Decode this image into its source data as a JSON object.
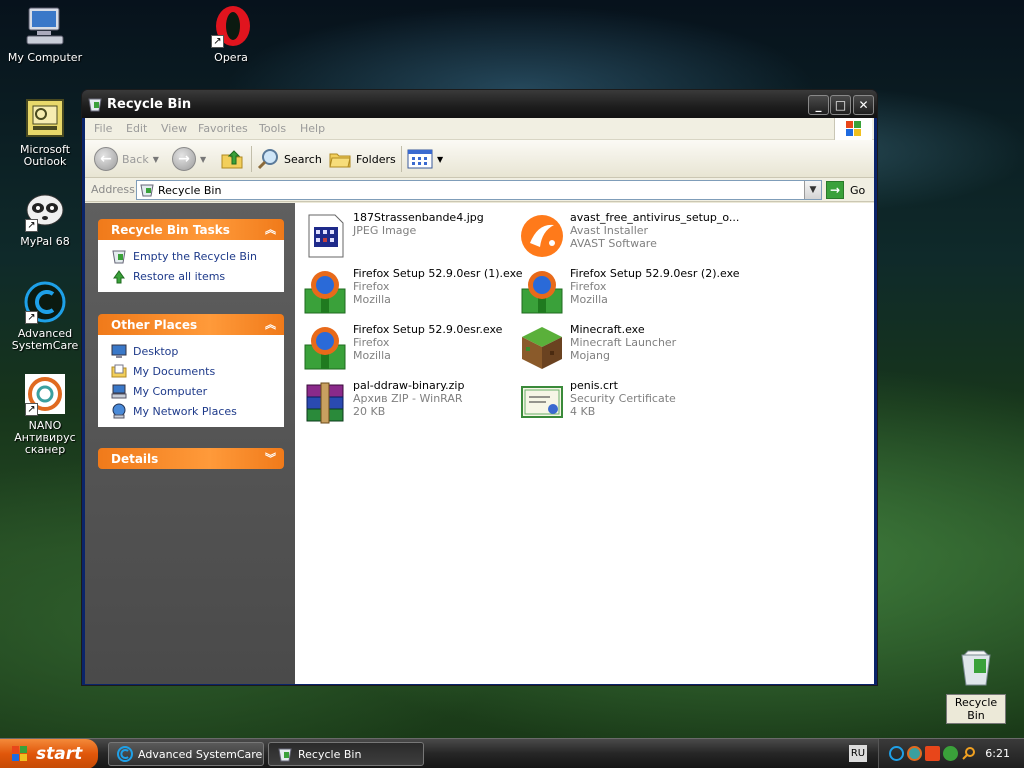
{
  "desktop": {
    "icons": [
      {
        "label": "My Computer"
      },
      {
        "label": "Opera"
      },
      {
        "label": "Microsoft Outlook"
      },
      {
        "label": "MyPal 68"
      },
      {
        "label": "Advanced SystemCare"
      },
      {
        "label": "NANO Антивирус сканер"
      }
    ],
    "recycle_bin_label": "Recycle Bin"
  },
  "window": {
    "title": "Recycle Bin",
    "menu": [
      "File",
      "Edit",
      "View",
      "Favorites",
      "Tools",
      "Help"
    ],
    "toolbar": {
      "back": "Back",
      "search": "Search",
      "folders": "Folders"
    },
    "address": {
      "label": "Address",
      "value": "Recycle Bin",
      "go": "Go"
    },
    "tasks_panel": {
      "title": "Recycle Bin Tasks",
      "items": [
        "Empty the Recycle Bin",
        "Restore all items"
      ]
    },
    "places_panel": {
      "title": "Other Places",
      "items": [
        "Desktop",
        "My Documents",
        "My Computer",
        "My Network Places"
      ]
    },
    "details_panel": {
      "title": "Details"
    },
    "files": [
      {
        "name": "187Strassenbande4.jpg",
        "type": "JPEG Image",
        "company": ""
      },
      {
        "name": "avast_free_antivirus_setup_o...",
        "type": "Avast Installer",
        "company": "AVAST Software"
      },
      {
        "name": "Firefox Setup 52.9.0esr (1).exe",
        "type": "Firefox",
        "company": "Mozilla"
      },
      {
        "name": "Firefox Setup 52.9.0esr (2).exe",
        "type": "Firefox",
        "company": "Mozilla"
      },
      {
        "name": "Firefox Setup 52.9.0esr.exe",
        "type": "Firefox",
        "company": "Mozilla"
      },
      {
        "name": "Minecraft.exe",
        "type": "Minecraft Launcher",
        "company": "Mojang"
      },
      {
        "name": "pal-ddraw-binary.zip",
        "type": "Архив ZIP - WinRAR",
        "company": "20 KB"
      },
      {
        "name": "penis.crt",
        "type": "Security Certificate",
        "company": "4 KB"
      }
    ]
  },
  "taskbar": {
    "start": "start",
    "tasks": [
      "Advanced SystemCare",
      "Recycle Bin"
    ],
    "lang": "RU",
    "clock": "6:21"
  }
}
